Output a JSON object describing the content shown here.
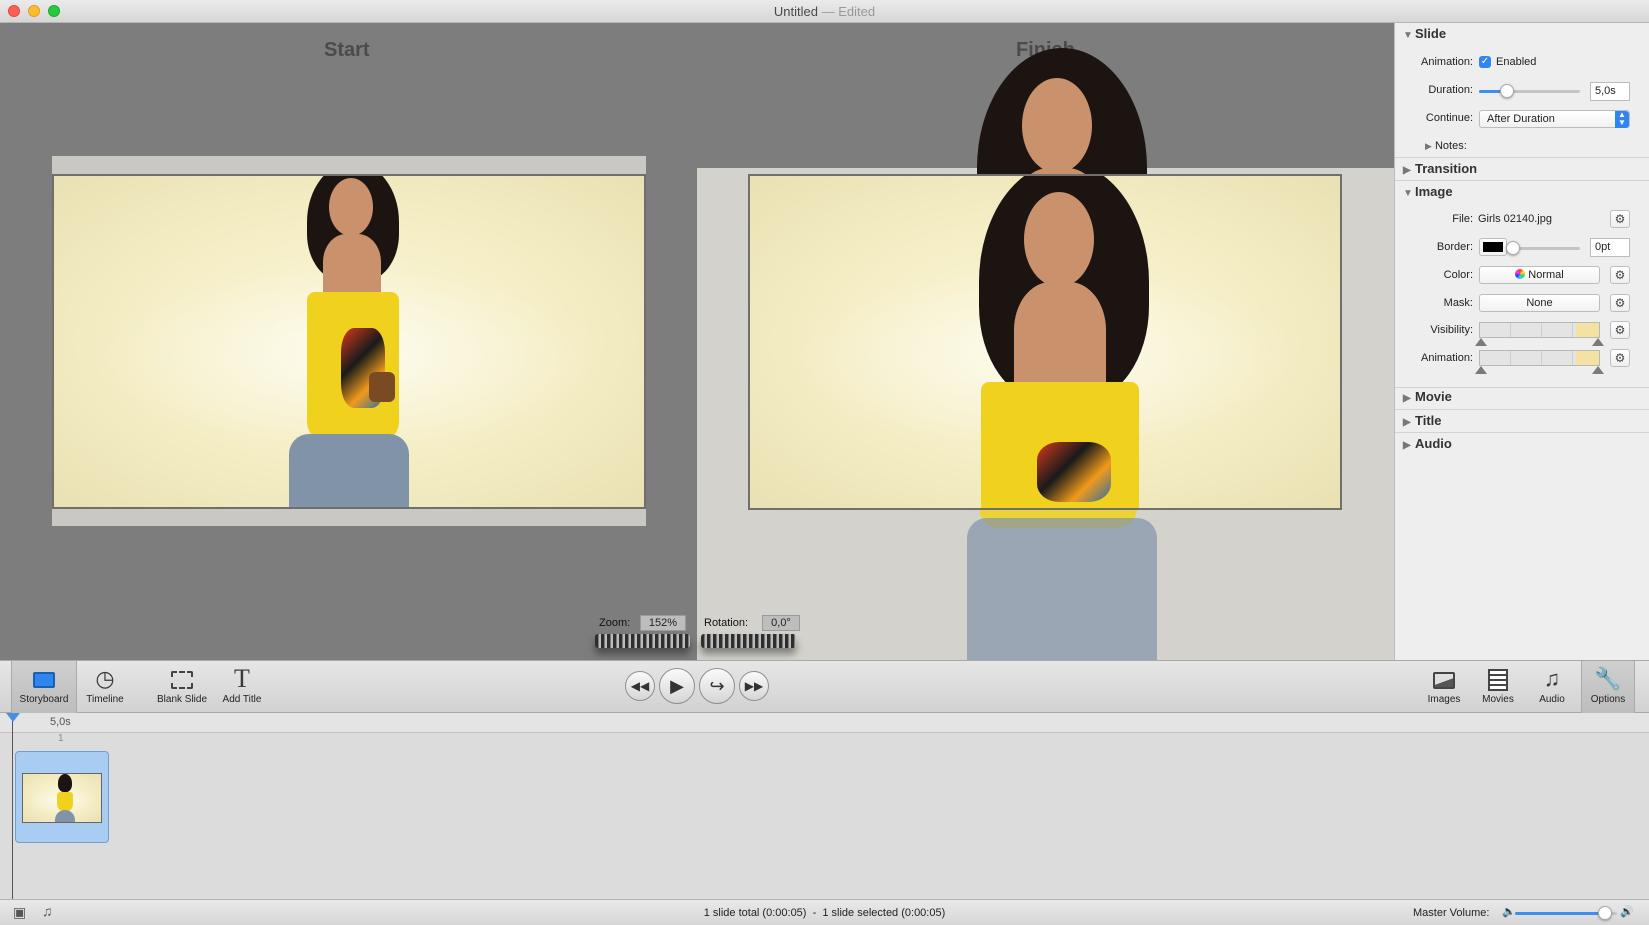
{
  "window": {
    "title": "Untitled",
    "separator": "—",
    "status": "Edited"
  },
  "stage": {
    "start_label": "Start",
    "finish_label": "Finish",
    "zoom_label": "Zoom:",
    "zoom_value": "152%",
    "rotation_label": "Rotation:",
    "rotation_value": "0,0°"
  },
  "inspector": {
    "slide": {
      "header": "Slide",
      "animation_label": "Animation:",
      "animation_checkbox": "Enabled",
      "animation_enabled": true,
      "duration_label": "Duration:",
      "duration_value": "5,0s",
      "duration_fraction": 0.28,
      "continue_label": "Continue:",
      "continue_value": "After Duration",
      "notes_label": "Notes:"
    },
    "transition": {
      "header": "Transition"
    },
    "image": {
      "header": "Image",
      "file_label": "File:",
      "file_value": "Girls 02140.jpg",
      "border_label": "Border:",
      "border_color": "#000000",
      "border_value": "0pt",
      "border_fraction": 0.0,
      "color_label": "Color:",
      "color_value": "Normal",
      "mask_label": "Mask:",
      "mask_value": "None",
      "visibility_label": "Visibility:",
      "animation_label": "Animation:"
    },
    "movie": {
      "header": "Movie"
    },
    "title": {
      "header": "Title"
    },
    "audio": {
      "header": "Audio"
    }
  },
  "toolbar": {
    "storyboard": "Storyboard",
    "timeline": "Timeline",
    "blank_slide": "Blank Slide",
    "add_title": "Add Title",
    "images": "Images",
    "movies": "Movies",
    "audio": "Audio",
    "options": "Options",
    "active": "storyboard",
    "active_right": "options"
  },
  "timeline": {
    "ruler_time": "5,0s",
    "slide_number": "1"
  },
  "status": {
    "summary": "1 slide total (0:00:05)  -  1 slide selected (0:00:05)",
    "master_volume_label": "Master Volume:",
    "master_volume_fraction": 0.88
  },
  "colors": {
    "accent": "#2f86f0",
    "selection": "#a9cdf2",
    "stage_bg": "#7d7d7d"
  }
}
